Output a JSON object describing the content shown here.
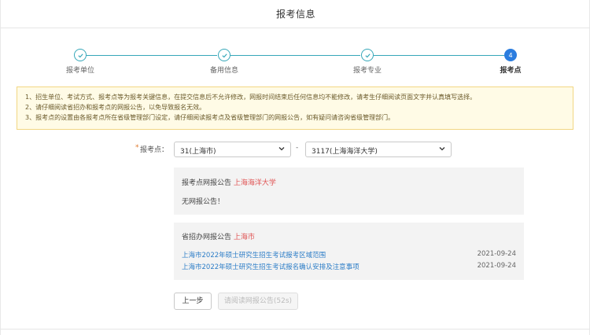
{
  "header": {
    "title": "报考信息"
  },
  "steps": [
    {
      "label": "报考单位",
      "state": "done"
    },
    {
      "label": "备用信息",
      "state": "done"
    },
    {
      "label": "报考专业",
      "state": "done"
    },
    {
      "label": "报考点",
      "state": "active",
      "number": "4"
    }
  ],
  "notice": {
    "lines": [
      "1、招生单位、考试方式、报考点等为报考关键信息，在提交信息后不允许修改，网报时间结束后任何信息均不能修改，请考生仔细阅读页面文字并认真填写选择。",
      "2、请仔细阅读省招办和报考点的网报公告，以免导致报名无效。",
      "3、报考点的设置由各报考点所在省级管理部门设定，请仔细阅读报考点及省级管理部门的网报公告，如有疑问请咨询省级管理部门。"
    ]
  },
  "select": {
    "required_mark": "*",
    "label": "报考点：",
    "province_value": "31(上海市)",
    "separator": "-",
    "site_value": "3117(上海海洋大学)"
  },
  "site_announcement": {
    "title": "报考点网报公告",
    "highlight": "上海海洋大学",
    "content": "无网报公告！"
  },
  "provincial_announcement": {
    "title": "省招办网报公告",
    "highlight": "上海市",
    "items": [
      {
        "text": "上海市2022年硕士研究生招生考试报考区域范围",
        "date": "2021-09-24"
      },
      {
        "text": "上海市2022年硕士研究生招生考试报名确认安排及注意事项",
        "date": "2021-09-24"
      }
    ]
  },
  "buttons": {
    "prev": "上一步",
    "next": "请阅读网报公告(52s)"
  },
  "colors": {
    "accent": "#36a7b9",
    "active_step": "#2b7ddf",
    "highlight": "#e05454",
    "link": "#2c7dc7",
    "notice_bg": "#fffbe6"
  }
}
